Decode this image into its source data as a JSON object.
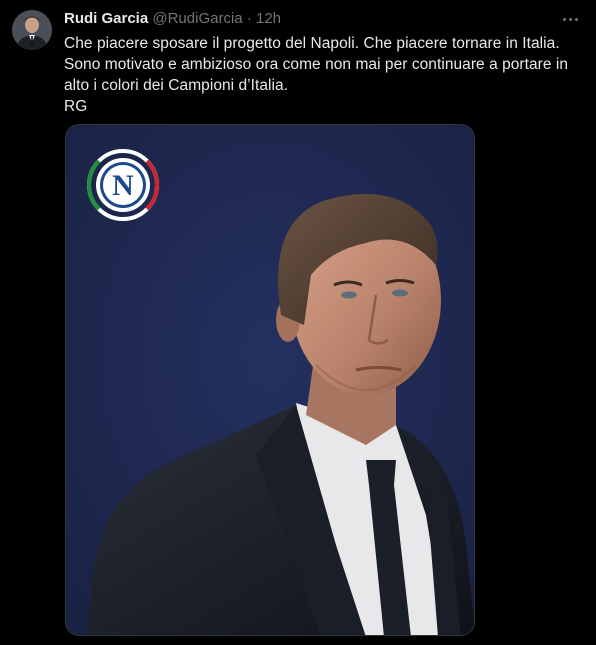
{
  "tweet": {
    "author_name": "Rudi Garcia",
    "author_handle": "@RudiGarcia",
    "separator": "·",
    "time": "12h",
    "text_lines": [
      "Che piacere sposare il progetto del Napoli. Che piacere tornare in Italia.",
      "Sono motivato e ambizioso ora come non mai per continuare a portare in",
      "alto i colori dei Campioni d’Italia.",
      "RG"
    ],
    "more_icon": "more-horizontal-icon"
  },
  "media": {
    "logo_letter": "N",
    "background_color": "#1e2749",
    "logo_colors": [
      "#1f8f3a",
      "#ffffff",
      "#cf2230"
    ]
  }
}
